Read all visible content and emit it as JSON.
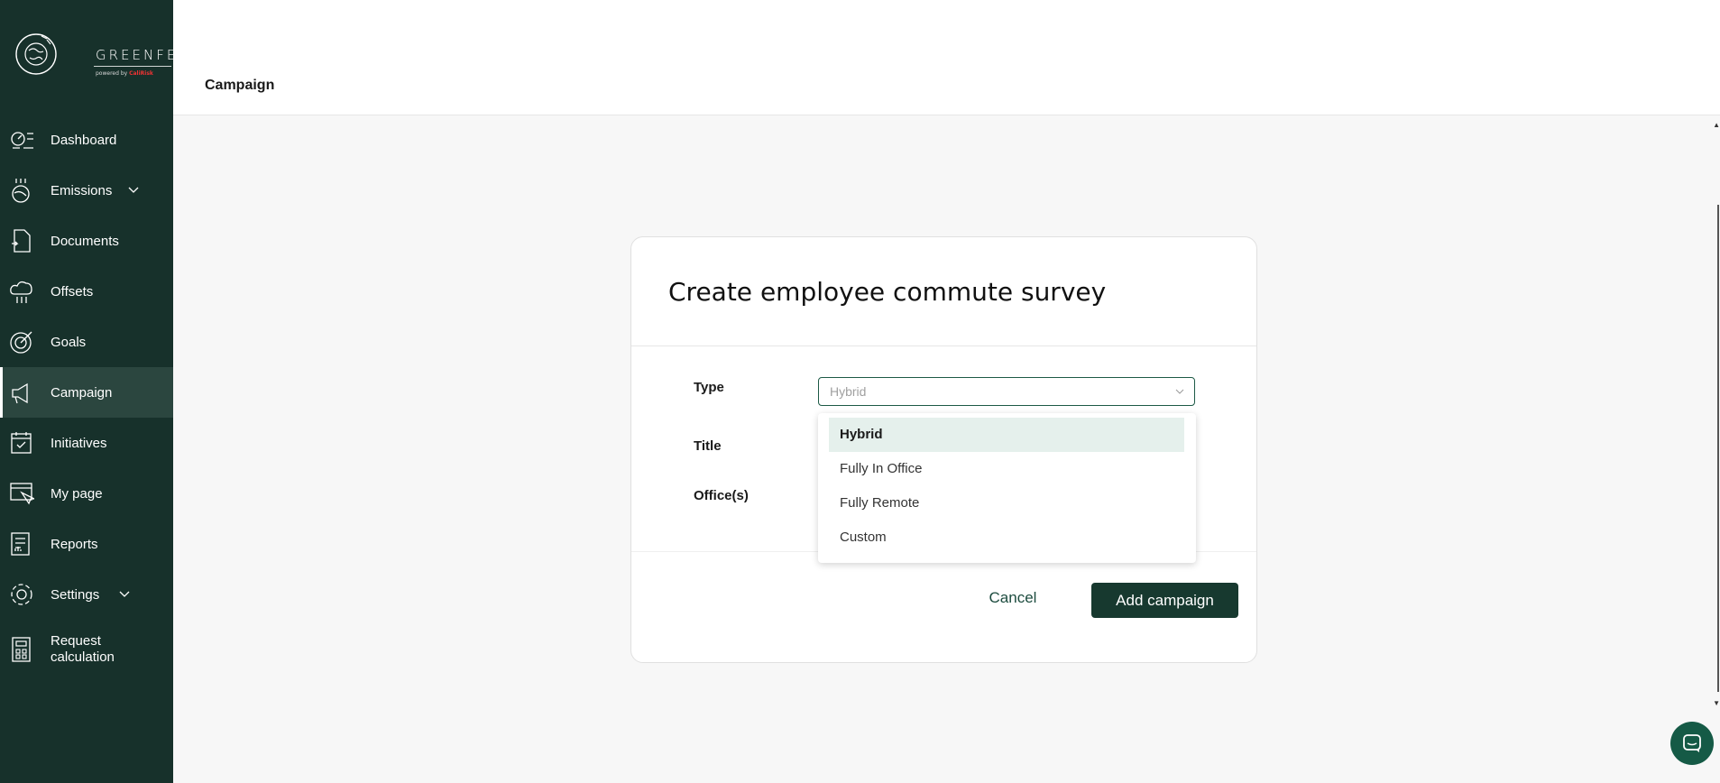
{
  "brand": {
    "name": "GREENFEET",
    "powered_prefix": "powered by",
    "powered_company": "CaliRisk"
  },
  "sidebar": {
    "items": [
      {
        "label": "Dashboard",
        "icon": "dashboard-icon"
      },
      {
        "label": "Emissions",
        "icon": "emissions-icon",
        "expandable": true
      },
      {
        "label": "Documents",
        "icon": "documents-icon"
      },
      {
        "label": "Offsets",
        "icon": "offsets-icon"
      },
      {
        "label": "Goals",
        "icon": "goals-icon"
      },
      {
        "label": "Campaign",
        "icon": "megaphone-icon",
        "active": true
      },
      {
        "label": "Initiatives",
        "icon": "calendar-check-icon"
      },
      {
        "label": "My page",
        "icon": "my-page-icon"
      },
      {
        "label": "Reports",
        "icon": "reports-icon"
      },
      {
        "label": "Settings",
        "icon": "gear-icon",
        "expandable": true
      },
      {
        "label": "Request calculation",
        "label_line1": "Request",
        "label_line2": "calculation",
        "icon": "calculator-icon"
      }
    ]
  },
  "header": {
    "title": "Campaign"
  },
  "modal": {
    "title": "Create employee commute survey",
    "fields": {
      "type_label": "Type",
      "type_value": "Hybrid",
      "title_label": "Title",
      "offices_label": "Office(s)"
    },
    "dropdown": {
      "options": [
        "Hybrid",
        "Fully In Office",
        "Fully Remote",
        "Custom"
      ],
      "selected": "Hybrid"
    },
    "cancel_label": "Cancel",
    "submit_label": "Add campaign"
  },
  "colors": {
    "sidebar_bg": "#17312b",
    "accent": "#17392f",
    "selected_option_bg": "#e5f0ec"
  }
}
